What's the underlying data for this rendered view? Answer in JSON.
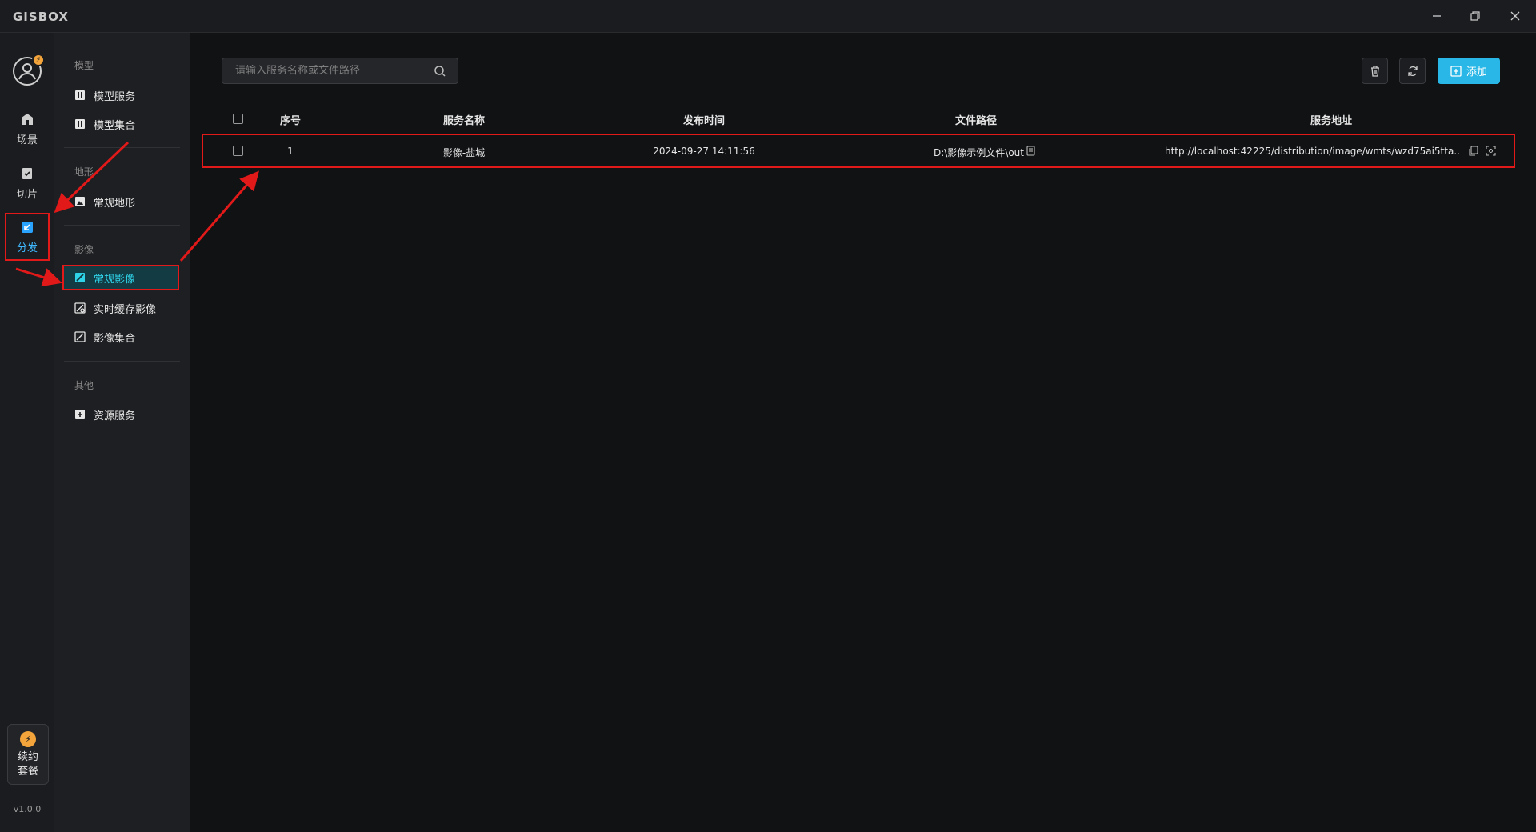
{
  "app": {
    "logo": "GISBOX",
    "window_controls": [
      "minimize-icon",
      "restore-icon",
      "close-icon"
    ]
  },
  "rail": {
    "avatar_icon": "user-icon",
    "items": [
      {
        "label": "场景",
        "icon": "home-icon"
      },
      {
        "label": "切片",
        "icon": "slice-icon"
      },
      {
        "label": "分发",
        "icon": "distribute-icon",
        "active": true
      }
    ],
    "renew": {
      "label_line1": "续约",
      "label_line2": "套餐",
      "icon": "bolt-icon"
    },
    "version": "v1.0.0"
  },
  "submenu": {
    "groups": [
      {
        "title": "模型",
        "items": [
          "模型服务",
          "模型集合"
        ]
      },
      {
        "title": "地形",
        "items": [
          "常规地形"
        ]
      },
      {
        "title": "影像",
        "items": [
          "常规影像",
          "实时缓存影像",
          "影像集合"
        ],
        "active_item": "常规影像"
      },
      {
        "title": "其他",
        "items": [
          "资源服务"
        ]
      }
    ]
  },
  "toolbar": {
    "search_placeholder": "请输入服务名称或文件路径",
    "add_label": "添加",
    "icons": [
      "search-icon",
      "delete-icon",
      "refresh-icon",
      "add-icon"
    ]
  },
  "table": {
    "columns": [
      "序号",
      "服务名称",
      "发布时间",
      "文件路径",
      "服务地址"
    ],
    "rows": [
      {
        "index": "1",
        "name": "影像-盐城",
        "time": "2024-09-27 14:11:56",
        "path": "D:\\影像示例文件\\out",
        "url": "http://localhost:42225/distribution/image/wmts/wzd75ai5tta..."
      }
    ]
  },
  "colors": {
    "accent": "#28b7e6",
    "highlight": "#e11919",
    "active_text": "#2fd3e8",
    "badge": "#f3a43b"
  }
}
